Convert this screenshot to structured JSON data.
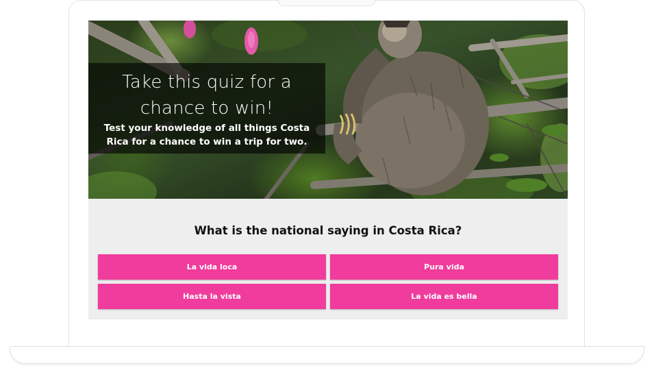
{
  "hero": {
    "title": "Take this quiz for a chance to win!",
    "subtitle": "Test your knowledge of all things Costa Rica for a chance to win a trip for two.",
    "image": "sloth-in-tree-photo"
  },
  "quiz": {
    "question": "What is the national saying in Costa Rica?",
    "answers": [
      {
        "label": "La vida loca"
      },
      {
        "label": "Pura vida"
      },
      {
        "label": "Hasta la vista"
      },
      {
        "label": "La vida es bella"
      }
    ]
  },
  "colors": {
    "answer_button": "#f03c9c",
    "quiz_background": "#eeeeee",
    "hero_overlay": "rgba(0,0,0,0.62)"
  }
}
